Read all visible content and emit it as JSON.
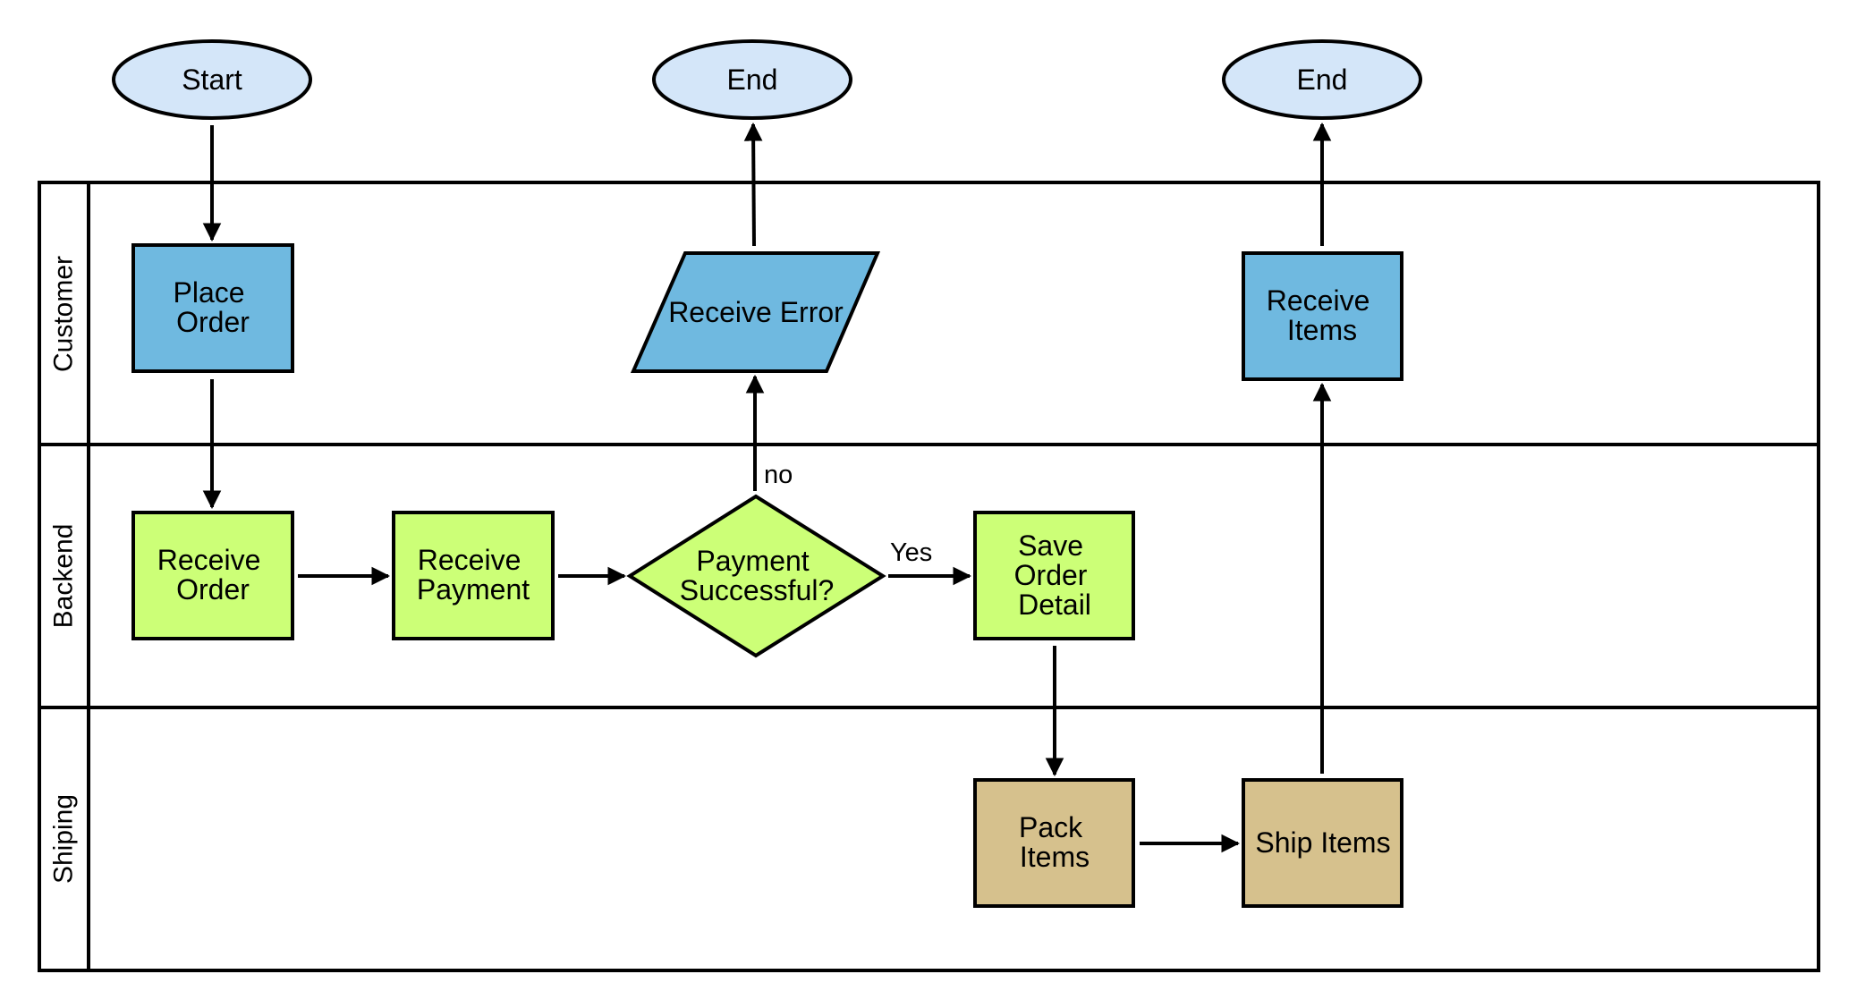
{
  "diagram": {
    "type": "swimlane-flowchart",
    "colors": {
      "terminal_fill": "#D4E6F9",
      "customer_fill": "#6FB9E0",
      "backend_fill": "#CCFF77",
      "shipping_fill": "#D6C18D",
      "line": "#000000",
      "background": "#FFFFFF"
    },
    "lanes": [
      {
        "id": "customer",
        "label": "Customer"
      },
      {
        "id": "backend",
        "label": "Backend"
      },
      {
        "id": "shipping",
        "label": "Shiping"
      }
    ],
    "terminals": {
      "start": {
        "label": "Start"
      },
      "end_error": {
        "label": "End"
      },
      "end_success": {
        "label": "End"
      }
    },
    "nodes": {
      "place_order": {
        "lines": [
          "Place",
          "Order"
        ],
        "lane": "customer",
        "shape": "rectangle"
      },
      "receive_error": {
        "lines": [
          "Receive Error"
        ],
        "lane": "customer",
        "shape": "parallelogram"
      },
      "receive_items": {
        "lines": [
          "Receive",
          "Items"
        ],
        "lane": "customer",
        "shape": "rectangle"
      },
      "receive_order": {
        "lines": [
          "Receive",
          "Order"
        ],
        "lane": "backend",
        "shape": "rectangle"
      },
      "receive_payment": {
        "lines": [
          "Receive",
          "Payment"
        ],
        "lane": "backend",
        "shape": "rectangle"
      },
      "payment_decision": {
        "lines": [
          "Payment",
          "Successful?"
        ],
        "lane": "backend",
        "shape": "diamond"
      },
      "save_order_detail": {
        "lines": [
          "Save",
          "Order",
          "Detail"
        ],
        "lane": "backend",
        "shape": "rectangle"
      },
      "pack_items": {
        "lines": [
          "Pack",
          "Items"
        ],
        "lane": "shipping",
        "shape": "rectangle"
      },
      "ship_items": {
        "lines": [
          "Ship Items"
        ],
        "lane": "shipping",
        "shape": "rectangle"
      }
    },
    "edges": [
      {
        "from": "start",
        "to": "place_order",
        "label": ""
      },
      {
        "from": "place_order",
        "to": "receive_order",
        "label": ""
      },
      {
        "from": "receive_order",
        "to": "receive_payment",
        "label": ""
      },
      {
        "from": "receive_payment",
        "to": "payment_decision",
        "label": ""
      },
      {
        "from": "payment_decision",
        "to": "receive_error",
        "label": "no"
      },
      {
        "from": "receive_error",
        "to": "end_error",
        "label": ""
      },
      {
        "from": "payment_decision",
        "to": "save_order_detail",
        "label": "Yes"
      },
      {
        "from": "save_order_detail",
        "to": "pack_items",
        "label": ""
      },
      {
        "from": "pack_items",
        "to": "ship_items",
        "label": ""
      },
      {
        "from": "ship_items",
        "to": "receive_items",
        "label": ""
      },
      {
        "from": "receive_items",
        "to": "end_success",
        "label": ""
      }
    ],
    "edge_labels": {
      "no": "no",
      "yes": "Yes"
    }
  }
}
